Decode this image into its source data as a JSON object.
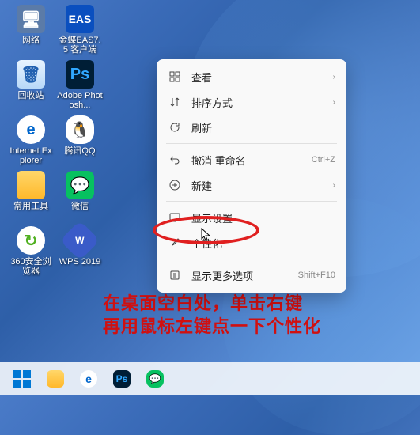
{
  "desktop": {
    "icons": [
      {
        "id": "network",
        "label": "网络"
      },
      {
        "id": "eas",
        "label": "金蝶EAS7.5 客户端"
      },
      {
        "id": "recycle",
        "label": "回收站"
      },
      {
        "id": "ps",
        "label": "Adobe Photosh..."
      },
      {
        "id": "ie",
        "label": "Internet Explorer"
      },
      {
        "id": "qq",
        "label": "腾讯QQ"
      },
      {
        "id": "folder",
        "label": "常用工具"
      },
      {
        "id": "wechat",
        "label": "微信"
      },
      {
        "id": "360",
        "label": "360安全浏览器"
      },
      {
        "id": "wps",
        "label": "WPS 2019"
      }
    ]
  },
  "context_menu": {
    "items": [
      {
        "icon": "grid",
        "label": "查看",
        "submenu": true
      },
      {
        "icon": "sort",
        "label": "排序方式",
        "submenu": true
      },
      {
        "icon": "refresh",
        "label": "刷新"
      }
    ],
    "items2": [
      {
        "icon": "undo",
        "label": "撤消 重命名",
        "shortcut": "Ctrl+Z"
      },
      {
        "icon": "plus",
        "label": "新建",
        "submenu": true
      }
    ],
    "items3": [
      {
        "icon": "display",
        "label": "显示设置"
      },
      {
        "icon": "brush",
        "label": "个性化"
      }
    ],
    "items4": [
      {
        "icon": "more",
        "label": "显示更多选项",
        "shortcut": "Shift+F10"
      }
    ]
  },
  "instruction": {
    "line1": "在桌面空白处，单击右键",
    "line2": "再用鼠标左键点一下个性化"
  },
  "icon_glyphs": {
    "network": "🖥",
    "recycle": "🗑",
    "ie": "e",
    "qq": "🐧",
    "wechat": "💬",
    "360": "↻",
    "eas": "EAS",
    "ps": "Ps",
    "folder": "",
    "wps_inner": "W"
  },
  "taskbar": {
    "items": [
      "start",
      "explorer",
      "ie",
      "ps",
      "wechat"
    ]
  }
}
